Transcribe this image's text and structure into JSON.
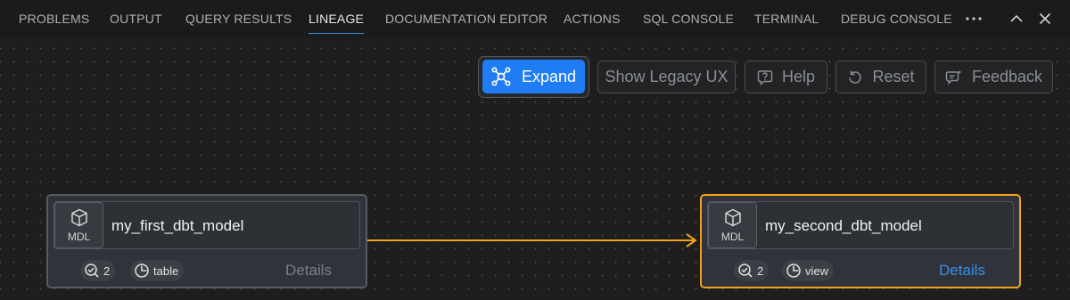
{
  "tabs": [
    {
      "label": "PROBLEMS",
      "active": false
    },
    {
      "label": "OUTPUT",
      "active": false
    },
    {
      "label": "QUERY RESULTS",
      "active": false
    },
    {
      "label": "LINEAGE",
      "active": true
    },
    {
      "label": "DOCUMENTATION EDITOR",
      "active": false
    },
    {
      "label": "ACTIONS",
      "active": false
    },
    {
      "label": "SQL CONSOLE",
      "active": false
    },
    {
      "label": "TERMINAL",
      "active": false
    },
    {
      "label": "DEBUG CONSOLE",
      "active": false
    }
  ],
  "tab_more_icon": "ellipsis-icon",
  "window_controls": [
    "chevron-up-icon",
    "close-icon"
  ],
  "toolbar": {
    "expand_label": "Expand",
    "legacy_label": "Show Legacy UX",
    "help_label": "Help",
    "reset_label": "Reset",
    "feedback_label": "Feedback"
  },
  "nodes": [
    {
      "badge": "MDL",
      "name": "my_first_dbt_model",
      "tests_count": "2",
      "materialization": "table",
      "details_label": "Details",
      "selected": false
    },
    {
      "badge": "MDL",
      "name": "my_second_dbt_model",
      "tests_count": "2",
      "materialization": "view",
      "details_label": "Details",
      "selected": true
    }
  ],
  "colors": {
    "accent": "#1f7cf2",
    "selected_border": "#f0a21c",
    "edge": "#f0a21c",
    "details_active": "#3a8ee8",
    "details_inactive": "#7a7f86"
  }
}
